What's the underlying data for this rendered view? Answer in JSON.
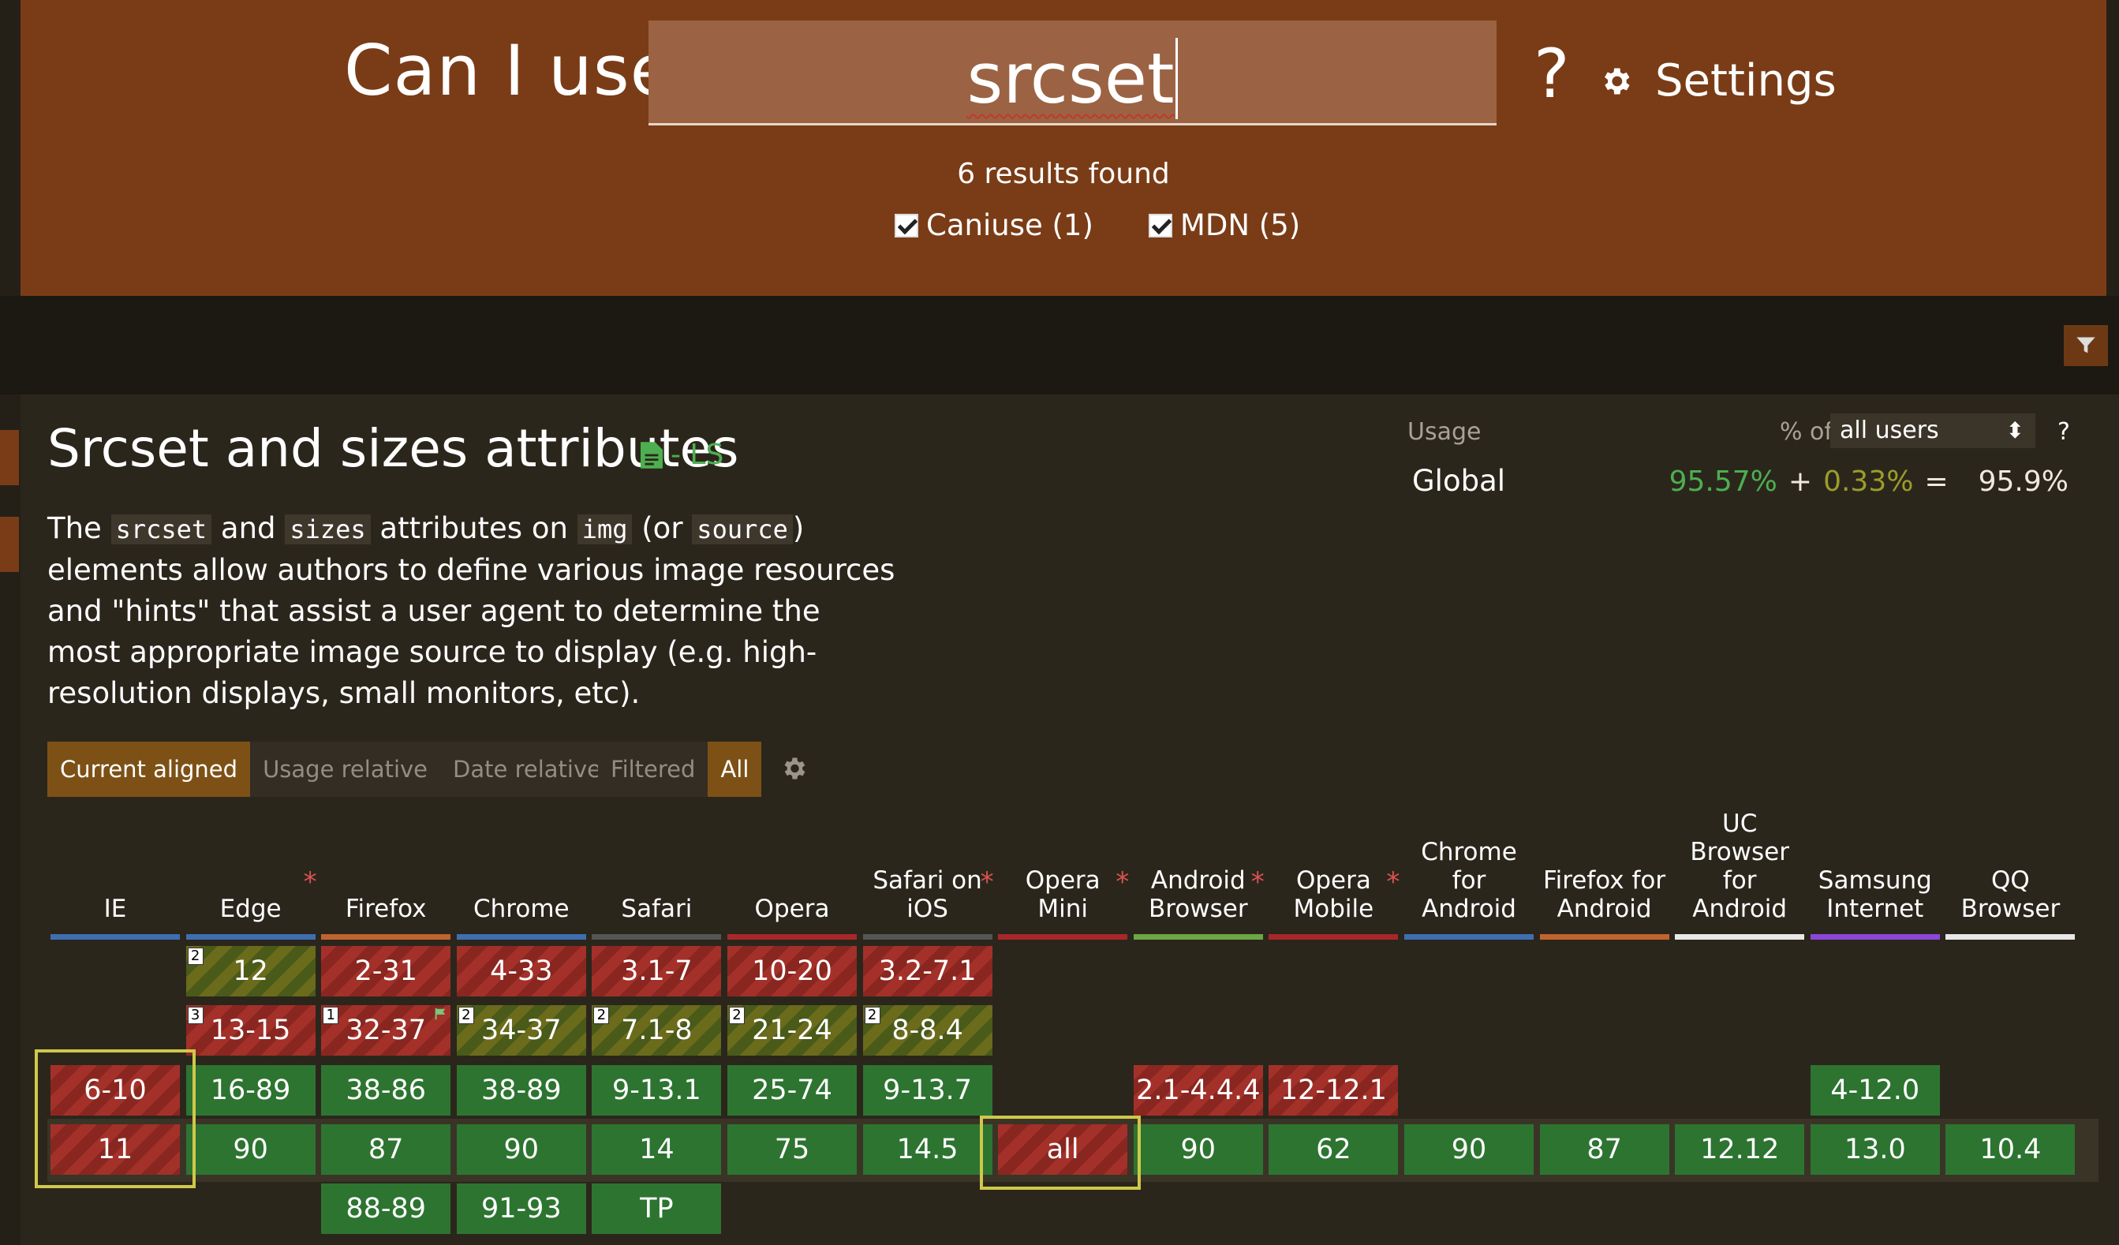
{
  "header": {
    "prefix": "Can I use",
    "search_value": "srcset",
    "suffix": "?",
    "settings_label": "Settings",
    "results_text": "6 results found",
    "filters": [
      {
        "label": "Caniuse (1)",
        "checked": true
      },
      {
        "label": "MDN (5)",
        "checked": true
      }
    ]
  },
  "feature": {
    "title": "Srcset and sizes attributes",
    "status": "- LS",
    "description": {
      "p1": "The ",
      "code1": "srcset",
      "p2": " and ",
      "code2": "sizes",
      "p3": " attributes on ",
      "code3": "img",
      "p4": " (or ",
      "code4": "source",
      "p5": ") elements allow authors to define various image resources and \"hints\" that assist a user agent to determine the most appropriate image source to display (e.g. high-resolution displays, small monitors, etc)."
    }
  },
  "usage": {
    "label": "Usage",
    "pct_of": "% of",
    "selected_users": "all users",
    "help": "?",
    "global_label": "Global",
    "full": "95.57%",
    "plus": "+",
    "partial": "0.33%",
    "equals": "=",
    "total": "95.9%"
  },
  "view_tabs": [
    "Current aligned",
    "Usage relative",
    "Date relative"
  ],
  "filter_tabs": [
    "Filtered",
    "All"
  ],
  "browsers": [
    {
      "name": "IE",
      "star": false,
      "bar": "#3f6fb0"
    },
    {
      "name": "Edge",
      "star": true,
      "bar": "#3f6fb0"
    },
    {
      "name": "Firefox",
      "star": false,
      "bar": "#c0642e"
    },
    {
      "name": "Chrome",
      "star": false,
      "bar": "#3f6fb0"
    },
    {
      "name": "Safari",
      "star": false,
      "bar": "#555555"
    },
    {
      "name": "Opera",
      "star": false,
      "bar": "#a8282a"
    },
    {
      "name": "Safari on iOS",
      "star": true,
      "bar": "#555555"
    },
    {
      "name": "Opera Mini",
      "star": true,
      "bar": "#a8282a"
    },
    {
      "name": "Android Browser",
      "star": true,
      "bar": "#6ca743"
    },
    {
      "name": "Opera Mobile",
      "star": true,
      "bar": "#a8282a"
    },
    {
      "name": "Chrome for Android",
      "star": false,
      "bar": "#3f6fb0"
    },
    {
      "name": "Firefox for Android",
      "star": false,
      "bar": "#c0642e"
    },
    {
      "name": "UC Browser for Android",
      "star": false,
      "bar": "#e8e8e8"
    },
    {
      "name": "Samsung Internet",
      "star": false,
      "bar": "#8b47d8"
    },
    {
      "name": "QQ Browser",
      "star": false,
      "bar": "#e8e8e8"
    }
  ],
  "support_cells": [
    {
      "col": 1,
      "row": 0,
      "label": "12",
      "support": "p",
      "note": "2"
    },
    {
      "col": 2,
      "row": 0,
      "label": "2-31",
      "support": "n"
    },
    {
      "col": 3,
      "row": 0,
      "label": "4-33",
      "support": "n"
    },
    {
      "col": 4,
      "row": 0,
      "label": "3.1-7",
      "support": "n"
    },
    {
      "col": 5,
      "row": 0,
      "label": "10-20",
      "support": "n"
    },
    {
      "col": 6,
      "row": 0,
      "label": "3.2-7.1",
      "support": "n"
    },
    {
      "col": 1,
      "row": 1,
      "label": "13-15",
      "support": "n",
      "note": "3"
    },
    {
      "col": 2,
      "row": 1,
      "label": "32-37",
      "support": "n",
      "note": "1",
      "flag": true
    },
    {
      "col": 3,
      "row": 1,
      "label": "34-37",
      "support": "p",
      "note": "2"
    },
    {
      "col": 4,
      "row": 1,
      "label": "7.1-8",
      "support": "p",
      "note": "2"
    },
    {
      "col": 5,
      "row": 1,
      "label": "21-24",
      "support": "p",
      "note": "2"
    },
    {
      "col": 6,
      "row": 1,
      "label": "8-8.4",
      "support": "p",
      "note": "2"
    },
    {
      "col": 0,
      "row": 2,
      "label": "6-10",
      "support": "n"
    },
    {
      "col": 1,
      "row": 2,
      "label": "16-89",
      "support": "y"
    },
    {
      "col": 2,
      "row": 2,
      "label": "38-86",
      "support": "y"
    },
    {
      "col": 3,
      "row": 2,
      "label": "38-89",
      "support": "y"
    },
    {
      "col": 4,
      "row": 2,
      "label": "9-13.1",
      "support": "y"
    },
    {
      "col": 5,
      "row": 2,
      "label": "25-74",
      "support": "y"
    },
    {
      "col": 6,
      "row": 2,
      "label": "9-13.7",
      "support": "y"
    },
    {
      "col": 8,
      "row": 2,
      "label": "2.1-4.4.4",
      "support": "n"
    },
    {
      "col": 9,
      "row": 2,
      "label": "12-12.1",
      "support": "n"
    },
    {
      "col": 13,
      "row": 2,
      "label": "4-12.0",
      "support": "y"
    },
    {
      "col": 0,
      "row": 3,
      "label": "11",
      "support": "n"
    },
    {
      "col": 1,
      "row": 3,
      "label": "90",
      "support": "y"
    },
    {
      "col": 2,
      "row": 3,
      "label": "87",
      "support": "y"
    },
    {
      "col": 3,
      "row": 3,
      "label": "90",
      "support": "y"
    },
    {
      "col": 4,
      "row": 3,
      "label": "14",
      "support": "y"
    },
    {
      "col": 5,
      "row": 3,
      "label": "75",
      "support": "y"
    },
    {
      "col": 6,
      "row": 3,
      "label": "14.5",
      "support": "y"
    },
    {
      "col": 7,
      "row": 3,
      "label": "all",
      "support": "n"
    },
    {
      "col": 8,
      "row": 3,
      "label": "90",
      "support": "y"
    },
    {
      "col": 9,
      "row": 3,
      "label": "62",
      "support": "y"
    },
    {
      "col": 10,
      "row": 3,
      "label": "90",
      "support": "y"
    },
    {
      "col": 11,
      "row": 3,
      "label": "87",
      "support": "y"
    },
    {
      "col": 12,
      "row": 3,
      "label": "12.12",
      "support": "y"
    },
    {
      "col": 13,
      "row": 3,
      "label": "13.0",
      "support": "y"
    },
    {
      "col": 14,
      "row": 3,
      "label": "10.4",
      "support": "y"
    },
    {
      "col": 2,
      "row": 4,
      "label": "88-89",
      "support": "y"
    },
    {
      "col": 3,
      "row": 4,
      "label": "91-93",
      "support": "y"
    },
    {
      "col": 4,
      "row": 4,
      "label": "TP",
      "support": "y"
    }
  ],
  "colors": {
    "header": "#7a3c16",
    "supported": "#2d7431",
    "unsupported": "#a3312a",
    "partial": "#6b6b1c",
    "full_usage": "#4caf50",
    "partial_usage": "#9c9c2a"
  }
}
